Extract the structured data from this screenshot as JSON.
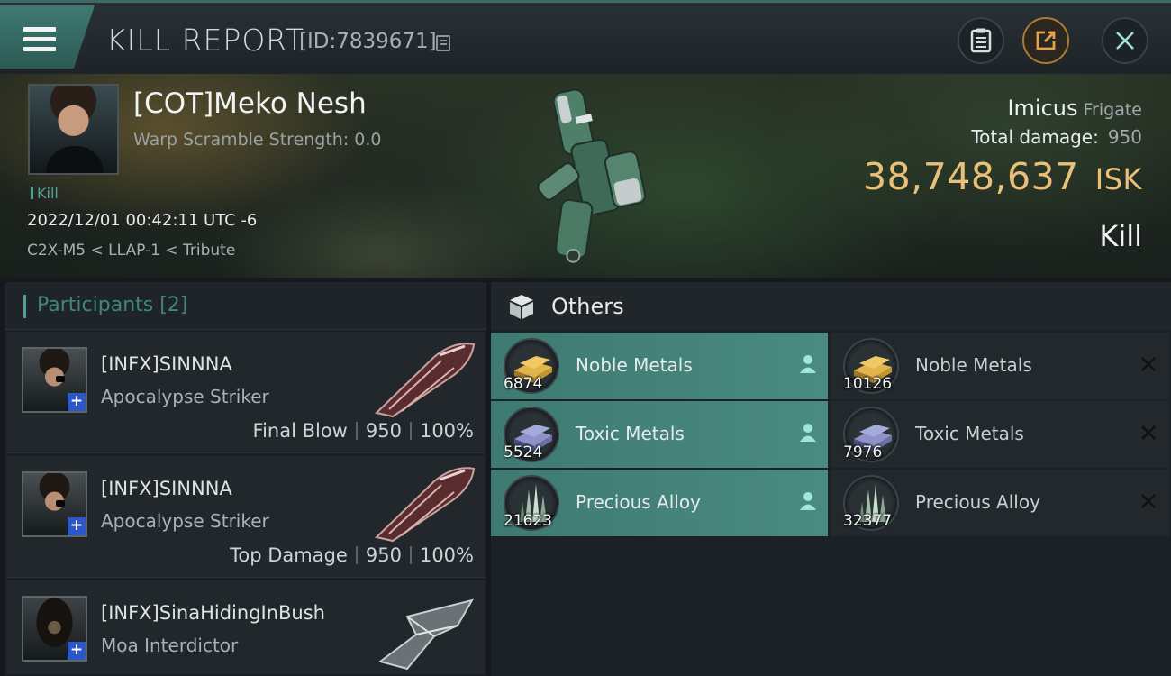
{
  "header": {
    "title": "KILL REPORT",
    "report_id": "[ID:7839671]"
  },
  "victim": {
    "name": "[COT]Meko Nesh",
    "warp_scramble": "Warp Scramble Strength: 0.0",
    "tag": "Kill",
    "timestamp": "2022/12/01 00:42:11 UTC -6",
    "location": "C2X-M5 < LLAP-1 < Tribute",
    "ship_name": "Imicus",
    "ship_class": "Frigate",
    "total_damage_label": "Total damage:",
    "total_damage": "950",
    "isk_value": "38,748,637",
    "isk_unit": "ISK",
    "result": "Kill"
  },
  "participants": {
    "title": "Participants [2]",
    "rows": [
      {
        "name": "[INFX]SINNNA",
        "ship": "Apocalypse Striker",
        "role": "Final Blow",
        "damage": "950",
        "percent": "100%"
      },
      {
        "name": "[INFX]SINNNA",
        "ship": "Apocalypse Striker",
        "role": "Top Damage",
        "damage": "950",
        "percent": "100%"
      },
      {
        "name": "[INFX]SinaHidingInBush",
        "ship": "Moa Interdictor"
      }
    ]
  },
  "others": {
    "title": "Others",
    "dropped": [
      {
        "name": "Noble Metals",
        "qty": "6874",
        "icon": "noble-metals-icon"
      },
      {
        "name": "Toxic Metals",
        "qty": "5524",
        "icon": "toxic-metals-icon"
      },
      {
        "name": "Precious Alloy",
        "qty": "21623",
        "icon": "precious-alloy-icon"
      }
    ],
    "destroyed": [
      {
        "name": "Noble Metals",
        "qty": "10126",
        "icon": "noble-metals-icon"
      },
      {
        "name": "Toxic Metals",
        "qty": "7976",
        "icon": "toxic-metals-icon"
      },
      {
        "name": "Precious Alloy",
        "qty": "32377",
        "icon": "precious-alloy-icon"
      }
    ]
  },
  "colors": {
    "accent_teal": "#4fa29a",
    "isk_gold": "#e9c07a",
    "dropped_bg": "#4a8a81",
    "badge_blue": "#2c58c7"
  }
}
